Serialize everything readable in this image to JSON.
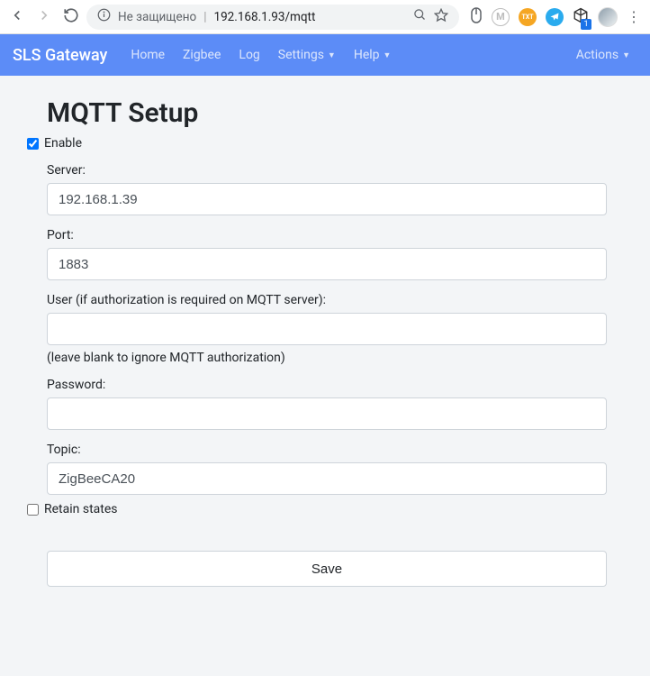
{
  "browser": {
    "not_secure": "Не защищено",
    "url": "192.168.1.93/mqtt"
  },
  "navbar": {
    "brand": "SLS Gateway",
    "home": "Home",
    "zigbee": "Zigbee",
    "log": "Log",
    "settings": "Settings",
    "help": "Help",
    "actions": "Actions"
  },
  "page": {
    "title": "MQTT Setup",
    "enable_label": "Enable",
    "enable_checked": true,
    "server_label": "Server:",
    "server_value": "192.168.1.39",
    "port_label": "Port:",
    "port_value": "1883",
    "user_label": "User (if authorization is required on MQTT server):",
    "user_value": "",
    "user_hint": "(leave blank to ignore MQTT authorization)",
    "password_label": "Password:",
    "password_value": "",
    "topic_label": "Topic:",
    "topic_value": "ZigBeeCA20",
    "retain_label": "Retain states",
    "retain_checked": false,
    "save_label": "Save"
  }
}
